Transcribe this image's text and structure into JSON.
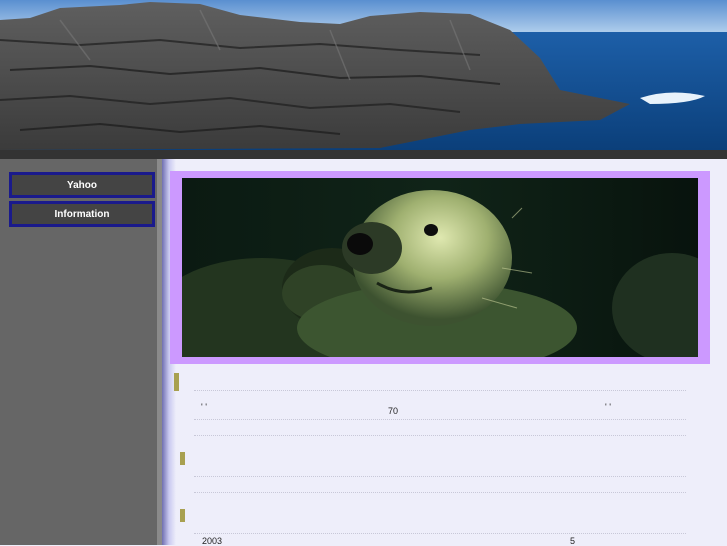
{
  "nav": {
    "items": [
      {
        "label": "Yahoo"
      },
      {
        "label": "Information"
      }
    ]
  },
  "content": {
    "row1": {
      "left_marks": "'  '",
      "center": "70",
      "right_marks": "'  '"
    },
    "row2": {
      "left": "2003",
      "right": "5"
    }
  }
}
